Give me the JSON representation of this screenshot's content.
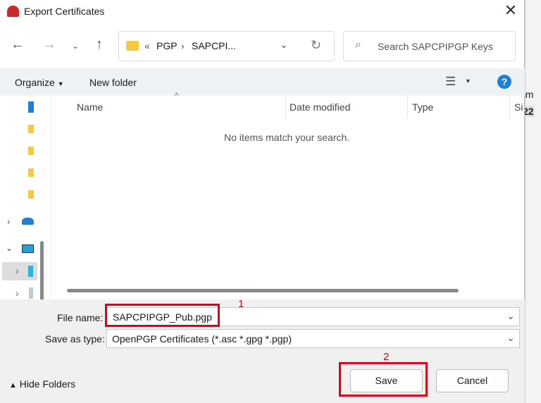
{
  "window": {
    "title": "Export Certificates"
  },
  "nav": {
    "breadcrumb": [
      "PGP",
      "SAPCPI..."
    ],
    "breadcrumb_prefix": "«",
    "search_placeholder": "Search SAPCPIPGP Keys"
  },
  "toolbar": {
    "organize": "Organize",
    "new_folder": "New folder",
    "help": "?"
  },
  "columns": [
    "Name",
    "Date modified",
    "Type",
    "Si"
  ],
  "empty_message": "No items match your search.",
  "form": {
    "file_name_label": "File name:",
    "file_name": "SAPCPIPGP_Pub.pgp",
    "save_type_label": "Save as type:",
    "save_type": "OpenPGP Certificates (*.asc *.gpg *.pgp)"
  },
  "footer": {
    "hide_folders": "Hide Folders",
    "save": "Save",
    "cancel": "Cancel"
  },
  "annotations": [
    "1",
    "2"
  ],
  "background": {
    "text1": "om",
    "text2": "22"
  }
}
